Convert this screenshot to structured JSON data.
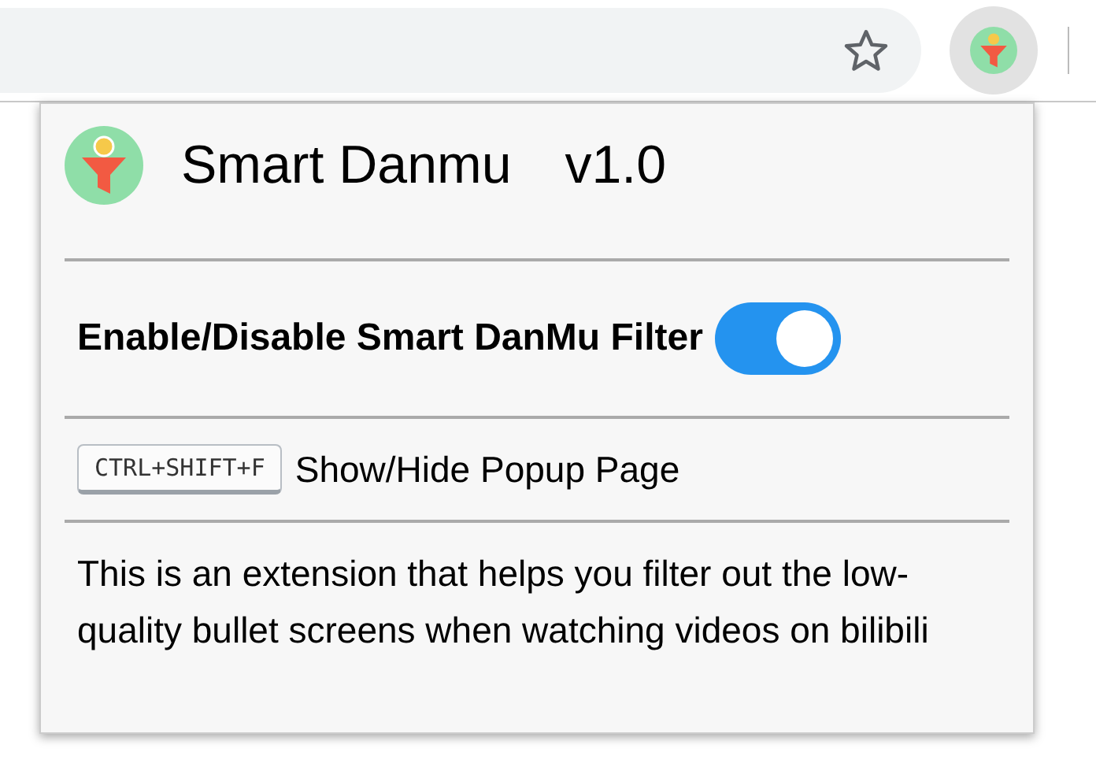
{
  "popup": {
    "title": "Smart Danmu",
    "version": "v1.0",
    "toggle": {
      "label": "Enable/Disable Smart DanMu Filter",
      "on": true
    },
    "shortcut": {
      "keys": "CTRL+SHIFT+F",
      "label": "Show/Hide Popup Page"
    },
    "description": "This is an extension that helps you filter out the low-quality bullet screens when watching videos on bilibili"
  }
}
